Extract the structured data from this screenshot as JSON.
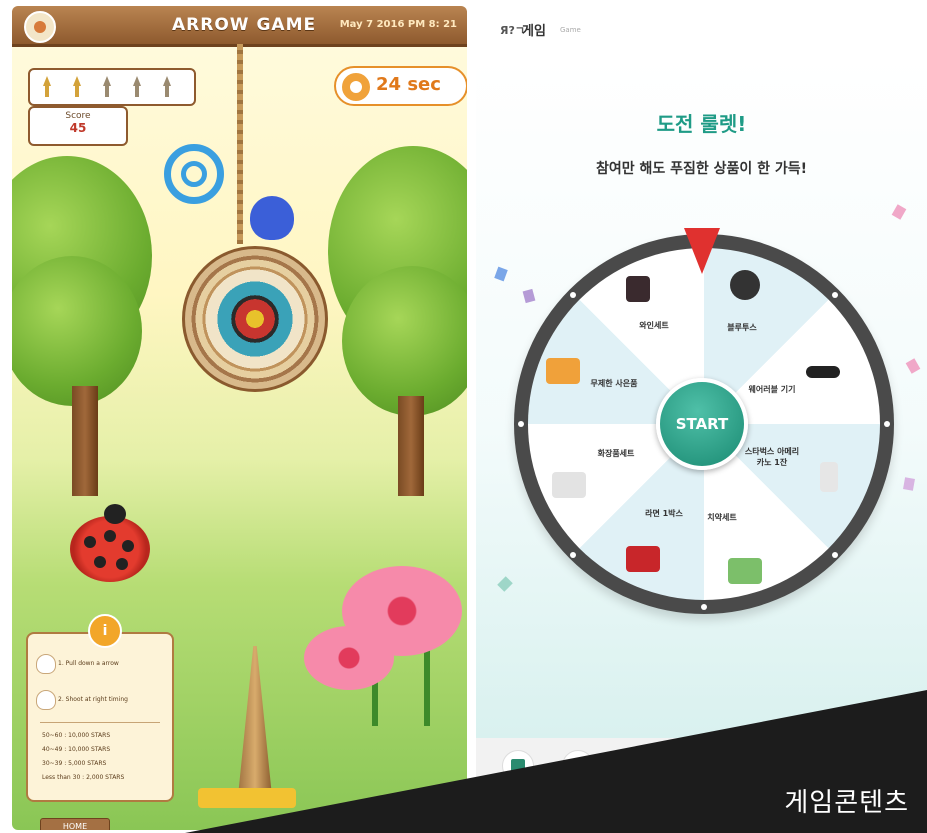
{
  "left_game": {
    "title": "ARROW GAME",
    "clock": "May 7 2016 PM 8: 21",
    "score_label": "Score",
    "score_value": "45",
    "timer": "24 sec",
    "info": {
      "badge": "i",
      "step1": "1. Pull down a arrow",
      "step2": "2. Shoot at right timing",
      "scores": [
        "50~60 : 10,000 STARS",
        "40~49 : 10,000 STARS",
        "30~39 : 5,000 STARS",
        "Less than 30 : 2,000 STARS"
      ]
    },
    "home_label": "HOME"
  },
  "right_game": {
    "logo": "Я?ㄱ",
    "title": "게임",
    "subtitle": "Game",
    "headline": "도전 룰렛!",
    "subheadline": "참여만 해도 푸짐한 상품이 한 가득!",
    "start_label": "START",
    "prizes": [
      "블루투스",
      "웨어러블 기기",
      "스타벅스 아메리카노 1잔",
      "치약세트",
      "라면 1박스",
      "화장품세트",
      "무제한 사은품",
      "와인세트"
    ]
  },
  "overlay_caption": "게임콘텐츠",
  "colors": {
    "wood": "#8e5a2e",
    "teal": "#1f9b86",
    "pointer_red": "#e0312f",
    "overlay": "#1c1c1c"
  }
}
